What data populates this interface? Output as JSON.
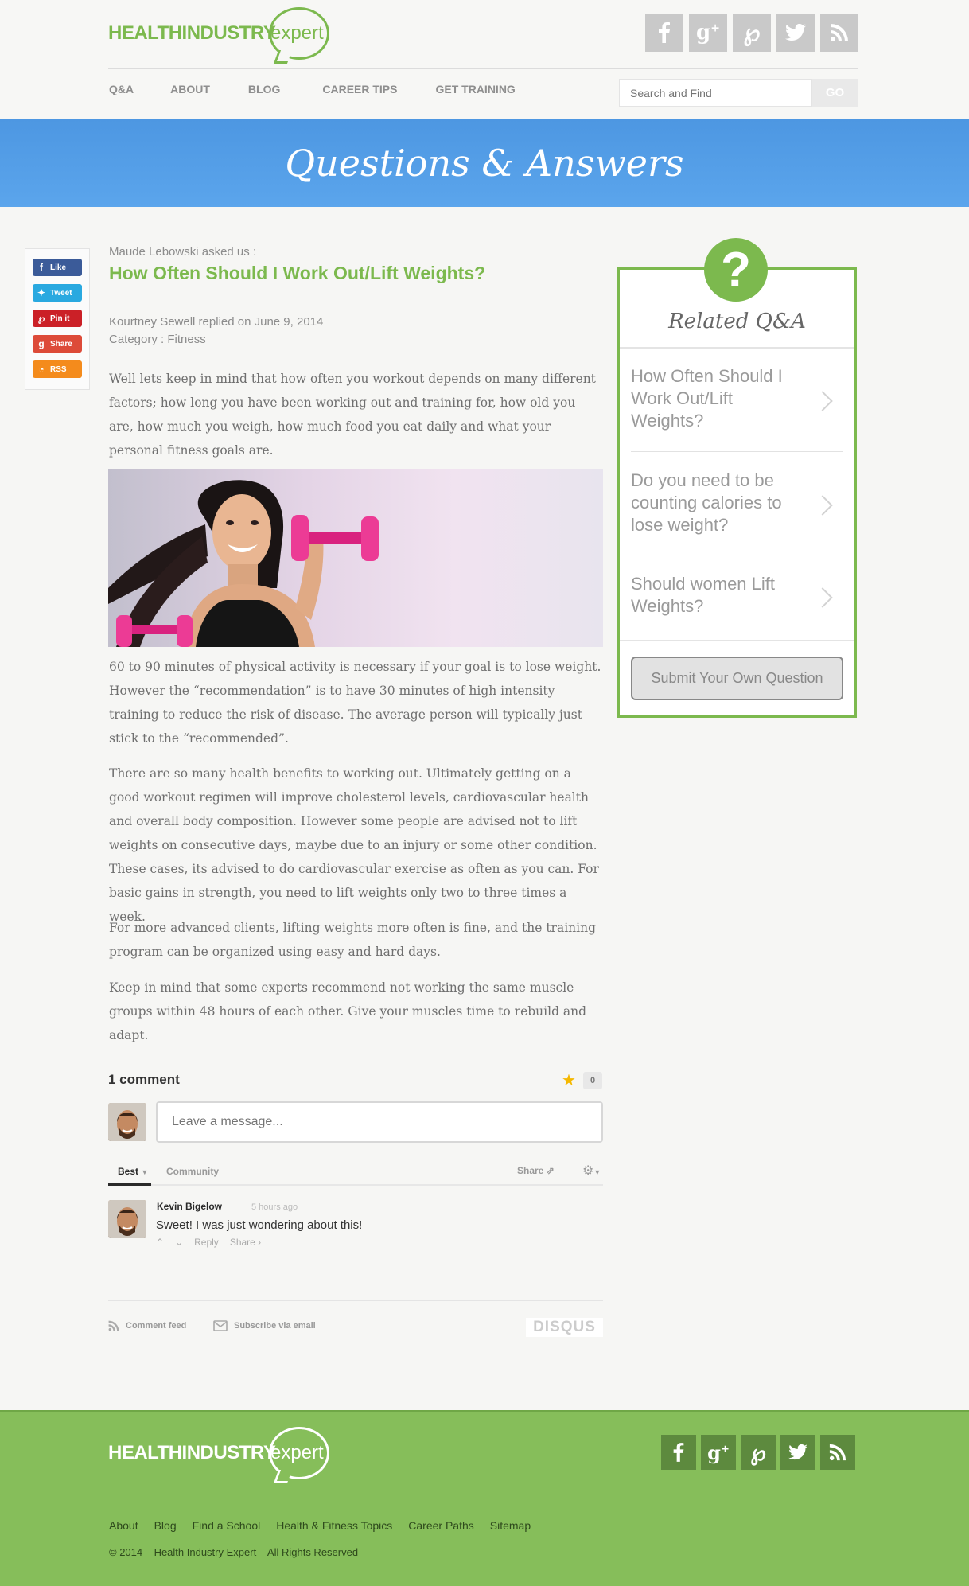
{
  "header": {
    "logo": {
      "bold_text": "HEALTHINDUSTRY",
      "script_text": "expert"
    },
    "social": [
      {
        "icon": "facebook-icon",
        "glyph": "f"
      },
      {
        "icon": "google-plus-icon",
        "glyph": "g+"
      },
      {
        "icon": "pinterest-icon",
        "glyph": "p"
      },
      {
        "icon": "twitter-icon",
        "glyph": "t"
      },
      {
        "icon": "rss-icon",
        "glyph": "rss"
      }
    ],
    "nav": [
      "Q&A",
      "ABOUT",
      "BLOG",
      "CAREER TIPS",
      "GET TRAINING"
    ],
    "search": {
      "placeholder": "Search and Find",
      "button": "GO"
    }
  },
  "banner": {
    "title": "Questions & Answers"
  },
  "share": [
    {
      "label": "Like",
      "icon": "facebook-icon",
      "glyph": "f",
      "color": "#3b5b99"
    },
    {
      "label": "Tweet",
      "icon": "twitter-icon",
      "glyph": "t",
      "color": "#2aa9e0"
    },
    {
      "label": "Pin it",
      "icon": "pinterest-icon",
      "glyph": "p",
      "color": "#cb2027"
    },
    {
      "label": "Share",
      "icon": "google-plus-icon",
      "glyph": "g+",
      "color": "#dd4b39"
    },
    {
      "label": "RSS",
      "icon": "rss-icon",
      "glyph": "rss",
      "color": "#f48b1c"
    }
  ],
  "article": {
    "asked_by": "Maude Lebowski asked us :",
    "title": "How Often Should I Work Out/Lift Weights?",
    "replied": "Kourtney Sewell replied on June 9, 2014",
    "category": "Category : Fitness",
    "paragraphs": [
      "Well lets keep in mind that how often you workout depends on many different factors; how long you have been working out and training for, how old you are, how much you weigh, how much food you eat daily and what your personal fitness goals are.",
      "60 to 90 minutes of physical activity is necessary if your goal is to lose weight. However the “recommendation” is to have 30 minutes of high intensity training to reduce the risk of disease. The average person will typically just stick to the “recommended”.",
      "There are so many health benefits to working out. Ultimately getting on a good workout regimen will improve cholesterol levels, cardiovascular health and overall body composition. However some people are advised not to lift weights on consecutive days, maybe due to an injury or some other condition. These cases, its advised to do cardiovascular exercise as often as you can. For basic gains in strength, you need to lift weights only two to three times a week.",
      "For more advanced clients, lifting weights more often is fine, and the training program can be organized using easy and hard days.",
      "Keep in mind that some experts recommend not working the same muscle groups within 48 hours of each other. Give your muscles time to rebuild and adapt."
    ]
  },
  "comments": {
    "count_label": "1 comment",
    "star_count": "0",
    "input_placeholder": "Leave a message...",
    "tab_best": "Best",
    "tab_community": "Community",
    "share": "Share",
    "items": [
      {
        "author": "Kevin Bigelow",
        "time": "5 hours ago",
        "text": "Sweet! I was just wondering about this!",
        "reply": "Reply",
        "share": "Share ›"
      }
    ],
    "comment_feed": "Comment feed",
    "subscribe": "Subscribe via email",
    "brand": "DISQUS"
  },
  "related": {
    "title": "Related Q&A",
    "items": [
      "How Often Should I Work Out/Lift Weights?",
      "Do you need to be counting calories to lose weight?",
      "Should women Lift Weights?"
    ],
    "submit": "Submit Your Own Question"
  },
  "footer": {
    "logo": {
      "bold_text": "HEALTHINDUSTRY",
      "script_text": "expert"
    },
    "links": [
      "About",
      "Blog",
      "Find a School",
      "Health & Fitness Topics",
      "Career Paths",
      "Sitemap"
    ],
    "copyright": "© 2014 – Health Industry Expert – All Rights Reserved"
  },
  "colors": {
    "brand_green": "#7cb94e",
    "banner_blue": "#5ba5ec",
    "footer_green": "#86be5a"
  }
}
